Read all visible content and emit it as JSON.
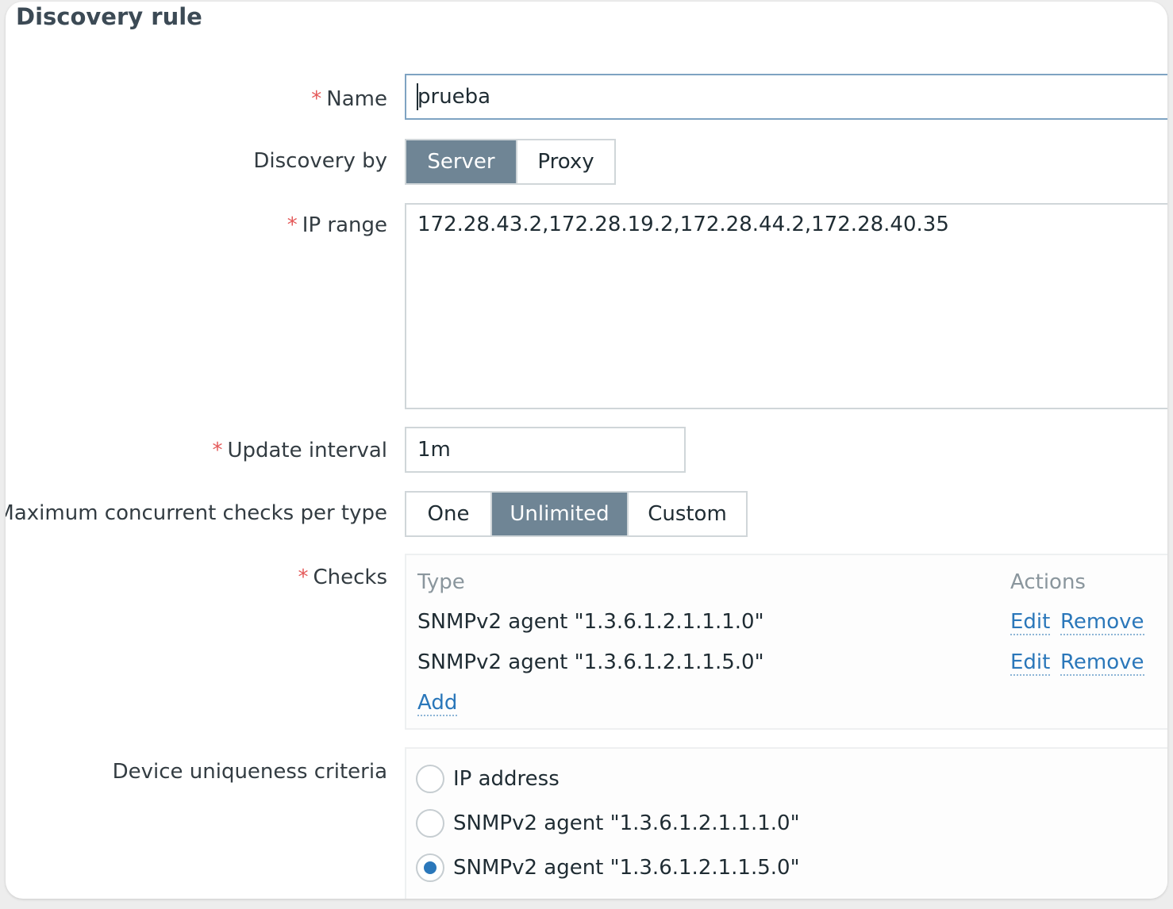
{
  "form": {
    "title": "Discovery rule",
    "required_mark": "*",
    "name": {
      "label": "Name",
      "value": "prueba"
    },
    "discovery_by": {
      "label": "Discovery by",
      "options": [
        "Server",
        "Proxy"
      ],
      "selected": "Server"
    },
    "ip_range": {
      "label": "IP range",
      "value": "172.28.43.2,172.28.19.2,172.28.44.2,172.28.40.35"
    },
    "update_interval": {
      "label": "Update interval",
      "value": "1m"
    },
    "max_checks": {
      "label": "Maximum concurrent checks per type",
      "options": [
        "One",
        "Unlimited",
        "Custom"
      ],
      "selected": "Unlimited"
    },
    "checks": {
      "label": "Checks",
      "columns": {
        "type": "Type",
        "actions": "Actions"
      },
      "rows": [
        {
          "type": "SNMPv2 agent \"1.3.6.1.2.1.1.1.0\"",
          "edit": "Edit",
          "remove": "Remove"
        },
        {
          "type": "SNMPv2 agent \"1.3.6.1.2.1.1.5.0\"",
          "edit": "Edit",
          "remove": "Remove"
        }
      ],
      "add_label": "Add"
    },
    "uniqueness": {
      "label": "Device uniqueness criteria",
      "options": [
        "IP address",
        "SNMPv2 agent \"1.3.6.1.2.1.1.1.0\"",
        "SNMPv2 agent \"1.3.6.1.2.1.1.5.0\""
      ],
      "selected": "SNMPv2 agent \"1.3.6.1.2.1.1.5.0\""
    }
  },
  "colors": {
    "accent": "#2a77ba",
    "segment_selected": "#6f8595",
    "required": "#e45959"
  }
}
